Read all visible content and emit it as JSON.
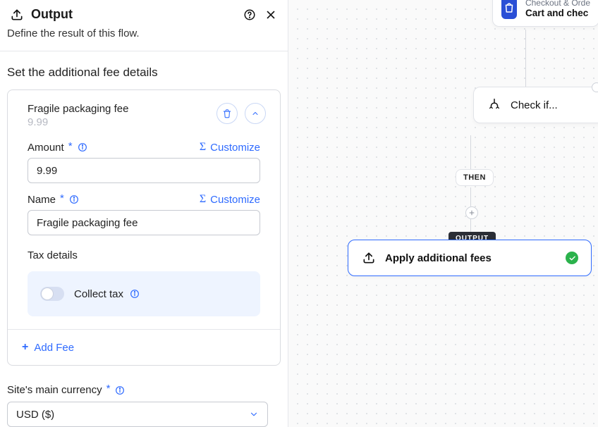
{
  "panel": {
    "title": "Output",
    "subtitle": "Define the result of this flow.",
    "section_title": "Set the additional fee details"
  },
  "fee": {
    "name_display": "Fragile packaging fee",
    "amount_display": "9.99",
    "amount_label": "Amount",
    "amount_value": "9.99",
    "name_label": "Name",
    "name_value": "Fragile packaging fee",
    "customize_label": "Customize",
    "tax_section_label": "Tax details",
    "collect_tax_label": "Collect tax",
    "add_fee_label": "Add Fee"
  },
  "currency": {
    "label": "Site's main currency",
    "value": "USD ($)"
  },
  "canvas": {
    "trigger_category": "Checkout & Orde",
    "trigger_name": "Cart and chec",
    "check_label": "Check if...",
    "then_label": "THEN",
    "output_tag": "OUTPUT",
    "output_label": "Apply additional fees"
  }
}
